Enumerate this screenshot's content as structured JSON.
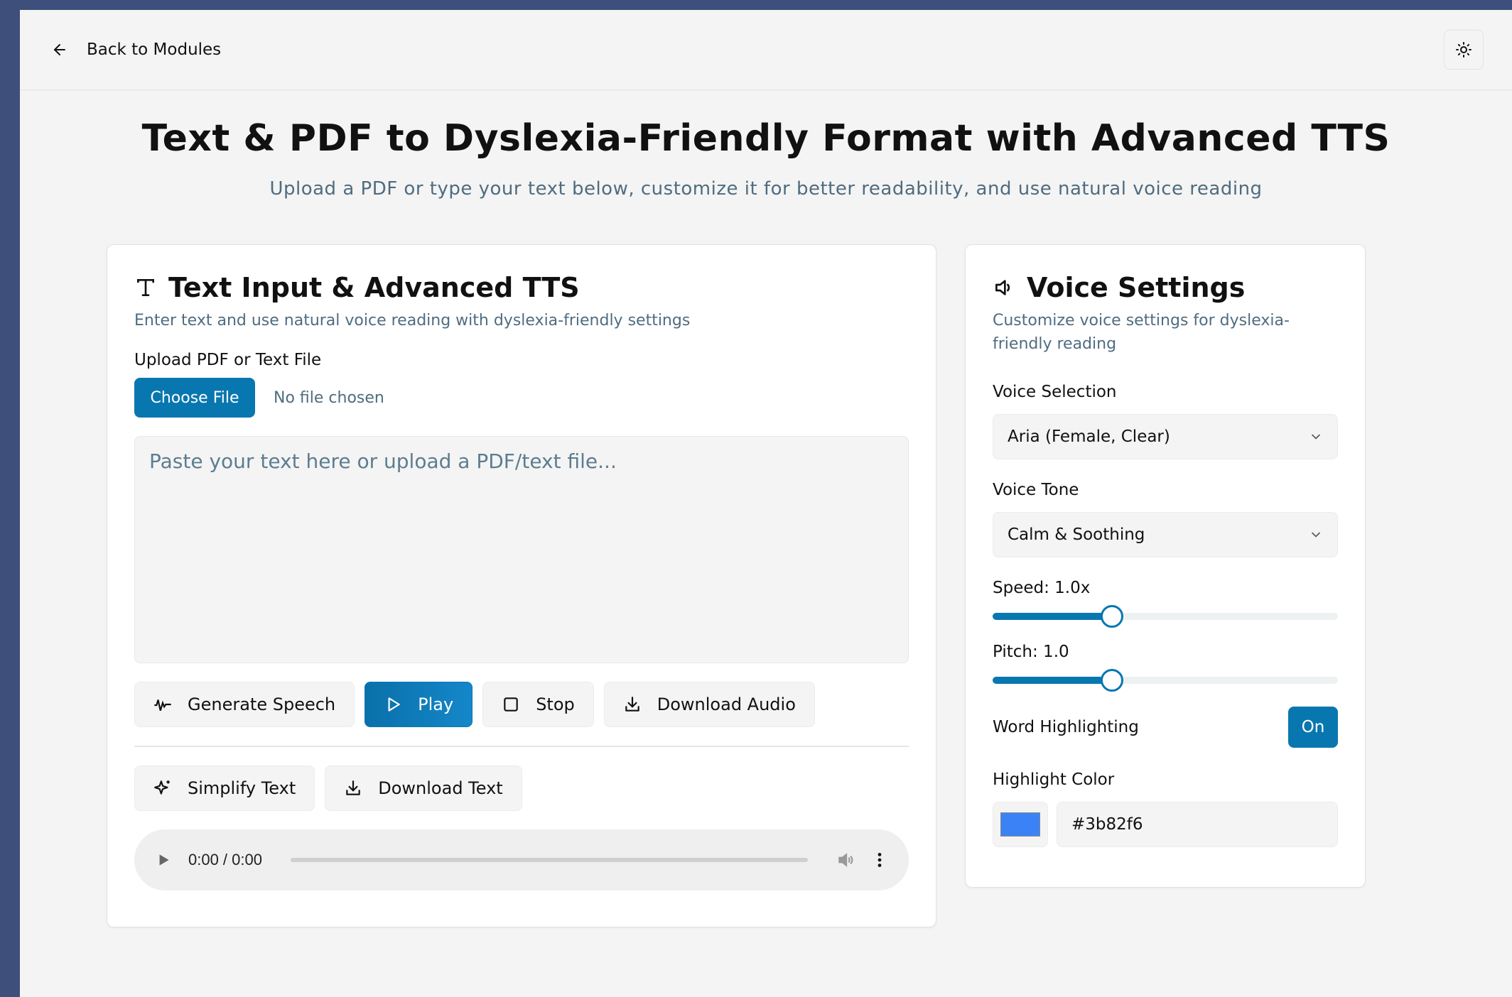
{
  "topbar": {
    "back_label": "Back to Modules"
  },
  "page": {
    "title": "Text & PDF to Dyslexia-Friendly Format with Advanced TTS",
    "subtitle": "Upload a PDF or type your text below, customize it for better readability, and use natural voice reading"
  },
  "text_card": {
    "title": "Text Input & Advanced TTS",
    "description": "Enter text and use natural voice reading with dyslexia-friendly settings",
    "upload_label": "Upload PDF or Text File",
    "choose_file_label": "Choose File",
    "no_file_text": "No file chosen",
    "textarea_placeholder": "Paste your text here or upload a PDF/text file...",
    "buttons": {
      "generate": "Generate Speech",
      "play": "Play",
      "stop": "Stop",
      "download_audio": "Download Audio",
      "simplify": "Simplify Text",
      "download_text": "Download Text"
    },
    "audio": {
      "time": "0:00 / 0:00"
    }
  },
  "voice_card": {
    "title": "Voice Settings",
    "description": "Customize voice settings for dyslexia-friendly reading",
    "voice_selection_label": "Voice Selection",
    "voice_selection_value": "Aria (Female, Clear)",
    "voice_tone_label": "Voice Tone",
    "voice_tone_value": "Calm & Soothing",
    "speed_label": "Speed: 1.0x",
    "speed_fraction": 0.345,
    "pitch_label": "Pitch: 1.0",
    "pitch_fraction": 0.345,
    "word_highlighting_label": "Word Highlighting",
    "word_highlighting_value": "On",
    "highlight_color_label": "Highlight Color",
    "highlight_color_value": "#3b82f6"
  },
  "colors": {
    "accent": "#0877b0",
    "highlight": "#3b82f6"
  }
}
